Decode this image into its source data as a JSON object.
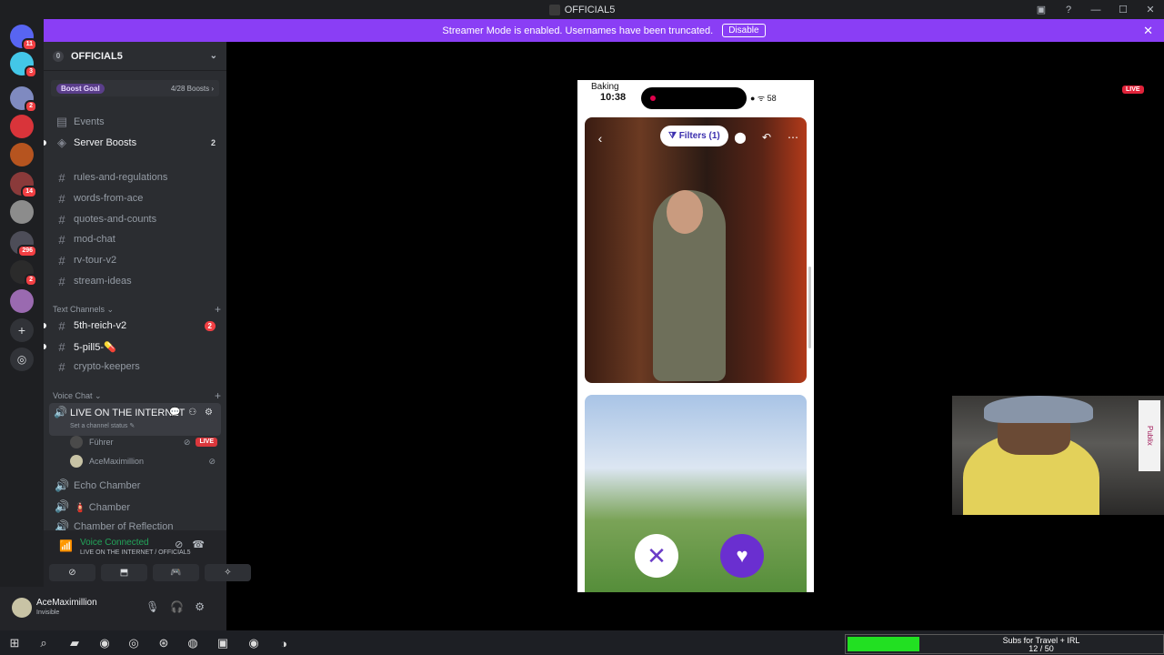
{
  "window": {
    "title": "OFFICIAL5",
    "controls": [
      "▣",
      "?",
      "—",
      "☐",
      "✕"
    ]
  },
  "banner": {
    "text": "Streamer Mode is enabled. Usernames have been truncated.",
    "button": "Disable",
    "close": "✕"
  },
  "servers": [
    {
      "badge": "11",
      "color": "#5865f2"
    },
    {
      "badge": "3",
      "color": "#43c7e8"
    },
    {
      "badge": "2",
      "color": "#7f8ac0"
    },
    {
      "badge": "",
      "color": "#d9343a"
    },
    {
      "badge": "",
      "color": "#b6541f"
    },
    {
      "badge": "14",
      "color": "#8a3a3a"
    },
    {
      "badge": "",
      "color": "#8c8c8c"
    },
    {
      "badge": "296",
      "color": "#4d4d58"
    },
    {
      "badge": "2",
      "color": "#2b2b2b"
    },
    {
      "badge": "",
      "color": "#9a6ab0"
    }
  ],
  "guild": {
    "icon": "0",
    "name": "OFFICIAL5",
    "chevron": "⌄",
    "boost_label": "Boost Goal",
    "boost_count": "4/28 Boosts ›"
  },
  "channels_top": [
    {
      "icon": "▤",
      "name": "Events",
      "bright": false,
      "count": ""
    },
    {
      "icon": "◈",
      "name": "Server Boosts",
      "bright": true,
      "count": "2"
    },
    {
      "icon": "#",
      "name": "rules-and-regulations",
      "bright": false,
      "count": ""
    },
    {
      "icon": "#",
      "name": "words-from-ace",
      "bright": false,
      "count": ""
    },
    {
      "icon": "#",
      "name": "quotes-and-counts",
      "bright": false,
      "count": ""
    },
    {
      "icon": "#",
      "name": "mod-chat",
      "bright": false,
      "count": ""
    },
    {
      "icon": "#",
      "name": "rv-tour-v2",
      "bright": false,
      "count": ""
    },
    {
      "icon": "#",
      "name": "stream-ideas",
      "bright": false,
      "count": ""
    }
  ],
  "text_category": "Text Channels ⌄",
  "text_channels": [
    {
      "name": "5th-reich-v2",
      "bright": true,
      "count": "2"
    },
    {
      "name": "5-pill5-💊",
      "bright": true,
      "count": ""
    },
    {
      "name": "crypto-keepers",
      "bright": false,
      "count": ""
    }
  ],
  "voice_category": "Voice Chat ⌄",
  "active_voice": {
    "name": "LIVE ON THE INTERNET",
    "status": "Set a channel status ✎",
    "icons": "💬 ⚇ ⚙",
    "users": [
      {
        "name": "Führer",
        "live": "LIVE",
        "color": "#4a4a4a"
      },
      {
        "name": "AceMaximillion",
        "live": "",
        "color": "#c8c3a5"
      }
    ]
  },
  "voice_channels": [
    {
      "name": "Echo Chamber"
    },
    {
      "name": "🧯 Chamber"
    },
    {
      "name": "Chamber of Reflection"
    }
  ],
  "rtc": {
    "title": "Voice Connected",
    "subtitle": "LIVE ON THE INTERNET / OFFICIAL5",
    "buttons": [
      "⊘",
      "⬒",
      "🎮",
      "✧"
    ]
  },
  "user": {
    "name": "AceMaximillion",
    "status": "Invisible"
  },
  "phone": {
    "app": "Baking",
    "time": "10:38",
    "status": "● ᯤ 58",
    "filter": "⧩ Filters (1)"
  },
  "stream_live": "LIVE",
  "webcam_sign": "Publix",
  "subgoal": {
    "title": "Subs for Travel + IRL",
    "count": "12 / 50",
    "progress": 0.24
  },
  "taskbar": [
    "⊞",
    "⌕",
    "▰",
    "◉",
    "◎",
    "⊛",
    "◍",
    "▣",
    "◉",
    "◑"
  ]
}
